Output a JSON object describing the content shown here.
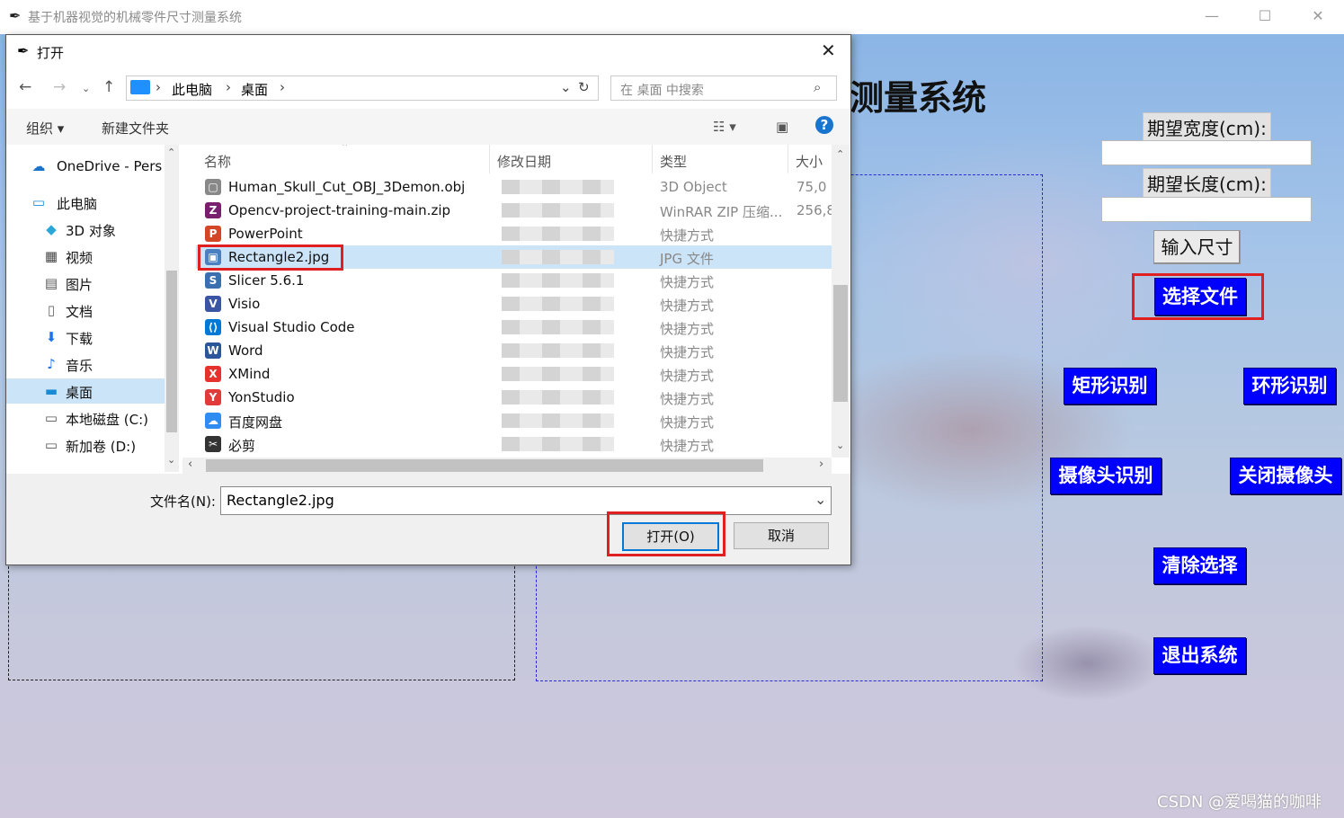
{
  "app": {
    "window_title": "基于机器视觉的机械零件尺寸测量系统",
    "heading_visible": "测量系统",
    "width_label": "期望宽度(cm):",
    "width_value": "",
    "length_label": "期望长度(cm):",
    "length_value": "",
    "buttons": {
      "input_size": "输入尺寸",
      "select_file": "选择文件",
      "rect_detect": "矩形识别",
      "ring_detect": "环形识别",
      "camera_detect": "摄像头识别",
      "close_camera": "关闭摄像头",
      "clear_selection": "清除选择",
      "exit_system": "退出系统"
    },
    "watermark": "CSDN @爱喝猫的咖啡"
  },
  "dialog": {
    "title": "打开",
    "breadcrumb": [
      "此电脑",
      "桌面"
    ],
    "search_placeholder": "在 桌面 中搜索",
    "toolbar": {
      "organize": "组织 ▾",
      "new_folder": "新建文件夹"
    },
    "nav_items": [
      {
        "label": "OneDrive - Pers",
        "icon": "cloud-icon"
      },
      {
        "label": "此电脑",
        "icon": "computer-icon"
      },
      {
        "label": "3D 对象",
        "icon": "cube-icon"
      },
      {
        "label": "视频",
        "icon": "video-icon"
      },
      {
        "label": "图片",
        "icon": "picture-icon"
      },
      {
        "label": "文档",
        "icon": "document-icon"
      },
      {
        "label": "下载",
        "icon": "download-icon"
      },
      {
        "label": "音乐",
        "icon": "music-icon"
      },
      {
        "label": "桌面",
        "icon": "desktop-icon"
      },
      {
        "label": "本地磁盘 (C:)",
        "icon": "drive-icon"
      },
      {
        "label": "新加卷 (D:)",
        "icon": "drive-icon"
      }
    ],
    "columns": {
      "name": "名称",
      "date": "修改日期",
      "type": "类型",
      "size": "大小"
    },
    "files": [
      {
        "name": "Human_Skull_Cut_OBJ_3Demon.obj",
        "type": "3D Object",
        "size": "75,0",
        "icon": "obj-file-icon",
        "color": "#888888"
      },
      {
        "name": "Opencv-project-training-main.zip",
        "type": "WinRAR ZIP 压缩...",
        "size": "256,8",
        "icon": "zip-file-icon",
        "color": "#7a1f6e"
      },
      {
        "name": "PowerPoint",
        "type": "快捷方式",
        "size": "",
        "icon": "powerpoint-icon",
        "color": "#d24726"
      },
      {
        "name": "Rectangle2.jpg",
        "type": "JPG 文件",
        "size": "",
        "icon": "image-file-icon",
        "color": "#4a7fc0"
      },
      {
        "name": "Slicer 5.6.1",
        "type": "快捷方式",
        "size": "",
        "icon": "slicer-icon",
        "color": "#3c6fb0"
      },
      {
        "name": "Visio",
        "type": "快捷方式",
        "size": "",
        "icon": "visio-icon",
        "color": "#3955a3"
      },
      {
        "name": "Visual Studio Code",
        "type": "快捷方式",
        "size": "",
        "icon": "vscode-icon",
        "color": "#0078d4"
      },
      {
        "name": "Word",
        "type": "快捷方式",
        "size": "",
        "icon": "word-icon",
        "color": "#2b579a"
      },
      {
        "name": "XMind",
        "type": "快捷方式",
        "size": "",
        "icon": "xmind-icon",
        "color": "#e5322d"
      },
      {
        "name": "YonStudio",
        "type": "快捷方式",
        "size": "",
        "icon": "yonstudio-icon",
        "color": "#e03a3a"
      },
      {
        "name": "百度网盘",
        "type": "快捷方式",
        "size": "",
        "icon": "baidu-netdisk-icon",
        "color": "#2f8cf0"
      },
      {
        "name": "必剪",
        "type": "快捷方式",
        "size": "",
        "icon": "bijian-icon",
        "color": "#333333"
      }
    ],
    "selected_file": "Rectangle2.jpg",
    "filename_label": "文件名(N):",
    "filename_value": "Rectangle2.jpg",
    "open_button": "打开(O)",
    "cancel_button": "取消"
  },
  "colors": {
    "accent_blue_button": "#0000ff",
    "highlight_red": "#e02020",
    "selection": "#cce4f7"
  }
}
